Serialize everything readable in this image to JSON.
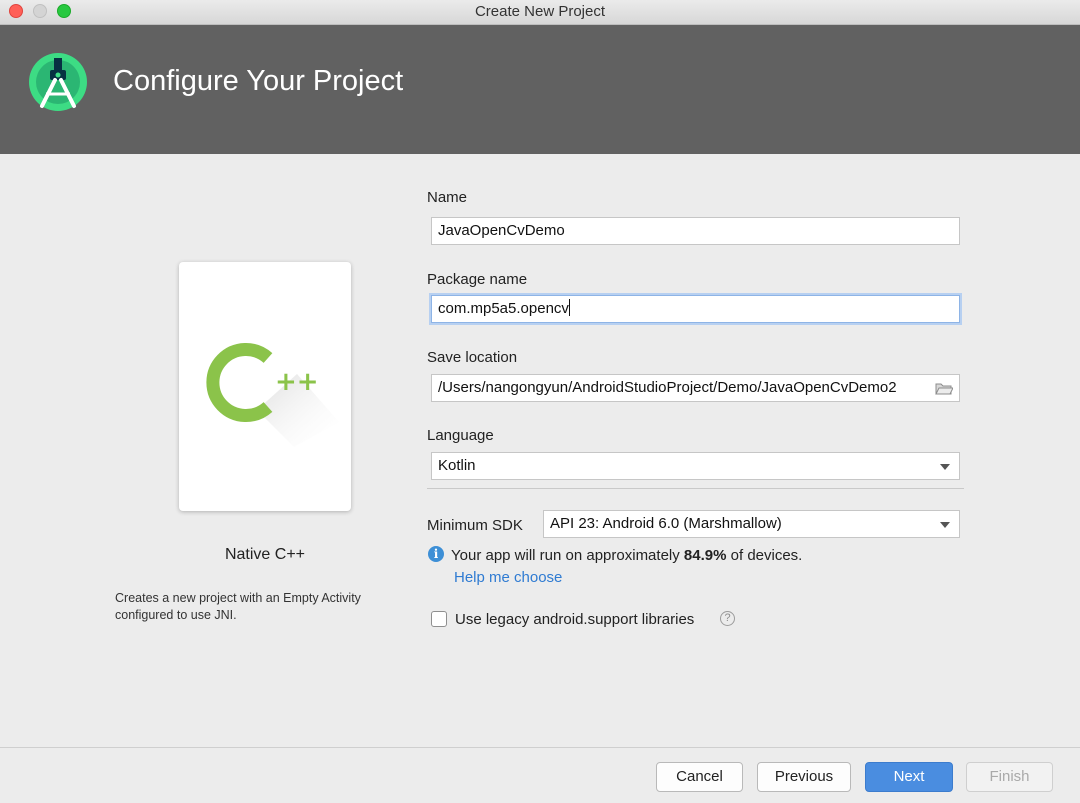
{
  "window": {
    "title": "Create New Project"
  },
  "header": {
    "title": "Configure Your Project",
    "logo_icon": "android-studio-icon"
  },
  "template": {
    "name": "Native C++",
    "icon": "cpp-icon",
    "description_line1": "Creates a new project with an Empty Activity",
    "description_line2": "configured to use JNI."
  },
  "form": {
    "name": {
      "label": "Name",
      "value": "JavaOpenCvDemo"
    },
    "package": {
      "label": "Package name",
      "value": "com.mp5a5.opencv"
    },
    "location": {
      "label": "Save location",
      "value": "/Users/nangongyun/AndroidStudioProject/Demo/JavaOpenCvDemo2",
      "icon": "folder-icon"
    },
    "language": {
      "label": "Language",
      "value": "Kotlin"
    },
    "min_sdk": {
      "label": "Minimum SDK",
      "value": "API 23: Android 6.0 (Marshmallow)"
    },
    "info": {
      "prefix": "Your app will run on approximately ",
      "percent": "84.9%",
      "suffix": " of devices.",
      "link": "Help me choose"
    },
    "legacy": {
      "label": "Use legacy android.support libraries",
      "checked": false,
      "help": "?"
    }
  },
  "buttons": {
    "cancel": "Cancel",
    "previous": "Previous",
    "next": "Next",
    "finish": "Finish"
  },
  "colors": {
    "header_bg": "#616161",
    "accent": "#4a8de0",
    "android_green": "#3ddc84",
    "cpp_green": "#8bc34a",
    "link": "#2f7bd2"
  }
}
